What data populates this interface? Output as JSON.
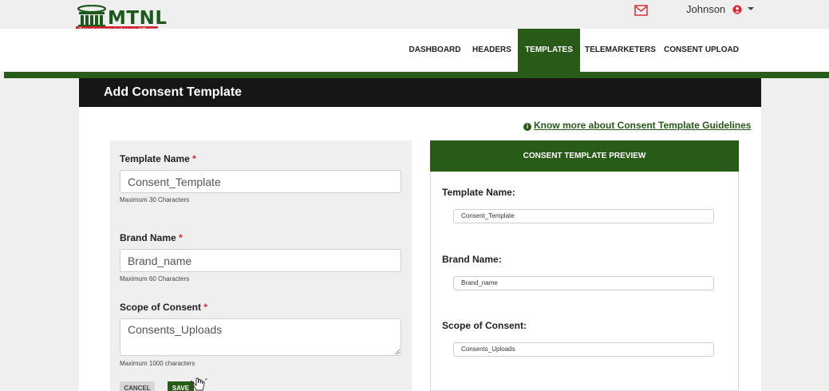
{
  "brand": {
    "name": "MTNL",
    "tagline": "Transparency makes us different",
    "primary_color": "#285a18",
    "accent_red": "#c9202c"
  },
  "header": {
    "mail_icon": "mail-icon",
    "user_name": "Johnson",
    "user_icon": "user-icon",
    "caret_icon": "caret-down-icon"
  },
  "nav": {
    "items": [
      {
        "label": "DASHBOARD",
        "active": false
      },
      {
        "label": "HEADERS",
        "active": false
      },
      {
        "label": "TEMPLATES",
        "active": true
      },
      {
        "label": "TELEMARKETERS",
        "active": false
      },
      {
        "label": "CONSENT UPLOAD",
        "active": false
      }
    ]
  },
  "panel": {
    "title": "Add Consent Template",
    "guidelines_link": "Know more about Consent Template Guidelines"
  },
  "form": {
    "required_marker": "*",
    "template_name": {
      "label": "Template Name",
      "value": "Consent_Template",
      "hint": "Maximum 30 Characters"
    },
    "brand_name": {
      "label": "Brand Name",
      "value": "Brand_name",
      "hint": "Maximum 60 Characters"
    },
    "scope": {
      "label": "Scope of Consent",
      "value": "Consents_Uploads",
      "hint": "Maximum 1000 characters"
    },
    "cancel_label": "CANCEL",
    "save_label": "SAVE"
  },
  "preview": {
    "heading": "CONSENT TEMPLATE PREVIEW",
    "template_name_label": "Template Name:",
    "template_name_value": "Consent_Template",
    "brand_name_label": "Brand Name:",
    "brand_name_value": "Brand_name",
    "scope_label": "Scope of Consent:",
    "scope_value": "Consents_Uploads"
  }
}
